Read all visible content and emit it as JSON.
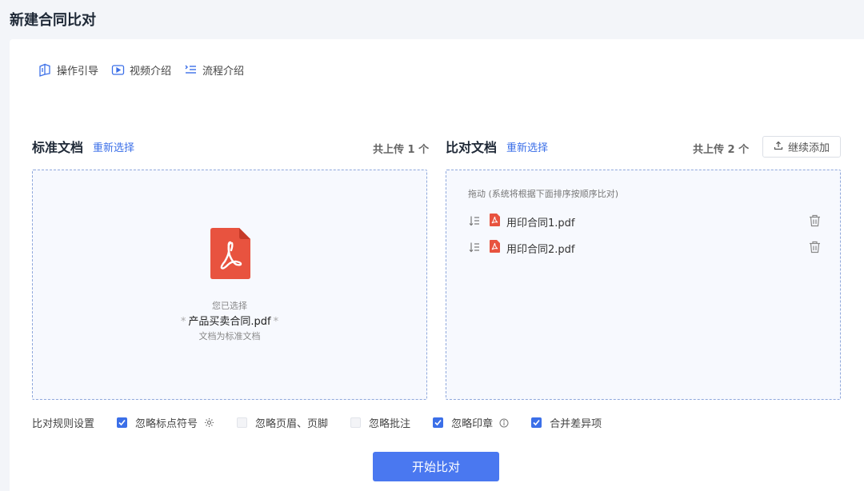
{
  "page": {
    "title": "新建合同比对"
  },
  "guides": [
    {
      "label": "操作引导",
      "icon": "book-icon"
    },
    {
      "label": "视频介绍",
      "icon": "play-icon"
    },
    {
      "label": "流程介绍",
      "icon": "list-icon"
    }
  ],
  "standard": {
    "title": "标准文档",
    "reselect": "重新选择",
    "count": "共上传 1 个",
    "chosen_caption": "您已选择",
    "file_name": "产品买卖合同.pdf",
    "star": "*",
    "note": "文档为标准文档"
  },
  "compare": {
    "title": "比对文档",
    "reselect": "重新选择",
    "count": "共上传 2 个",
    "continue_label": "继续添加",
    "drag_tip": "拖动 (系统将根据下面排序按顺序比对)",
    "files": [
      {
        "name": "用印合同1.pdf"
      },
      {
        "name": "用印合同2.pdf"
      }
    ]
  },
  "rules": {
    "label": "比对规则设置",
    "options": [
      {
        "label": "忽略标点符号",
        "checked": true,
        "extra_icon": "settings-icon"
      },
      {
        "label": "忽略页眉、页脚",
        "checked": false
      },
      {
        "label": "忽略批注",
        "checked": false
      },
      {
        "label": "忽略印章",
        "checked": true,
        "extra_icon": "info-icon"
      },
      {
        "label": "合并差异项",
        "checked": true
      }
    ]
  },
  "start_label": "开始比对",
  "colors": {
    "accent": "#3b6fe8",
    "pdf_red": "#e8533f",
    "panel_border": "#8fa8dc"
  }
}
